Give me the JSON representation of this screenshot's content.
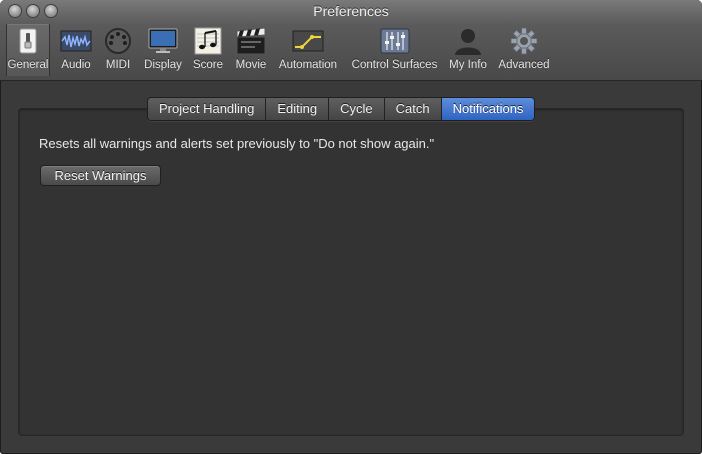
{
  "window": {
    "title": "Preferences"
  },
  "toolbar": {
    "items": [
      {
        "label": "General",
        "icon": "general-switch-icon",
        "selected": true
      },
      {
        "label": "Audio",
        "icon": "audio-waveform-icon"
      },
      {
        "label": "MIDI",
        "icon": "midi-connector-icon"
      },
      {
        "label": "Display",
        "icon": "display-monitor-icon"
      },
      {
        "label": "Score",
        "icon": "score-notes-icon"
      },
      {
        "label": "Movie",
        "icon": "movie-clapper-icon"
      },
      {
        "label": "Automation",
        "icon": "automation-curve-icon"
      },
      {
        "label": "Control Surfaces",
        "icon": "control-surfaces-faders-icon"
      },
      {
        "label": "My Info",
        "icon": "user-silhouette-icon"
      },
      {
        "label": "Advanced",
        "icon": "advanced-gear-icon"
      }
    ]
  },
  "tabs": {
    "items": [
      {
        "label": "Project Handling"
      },
      {
        "label": "Editing"
      },
      {
        "label": "Cycle"
      },
      {
        "label": "Catch"
      },
      {
        "label": "Notifications",
        "selected": true
      }
    ]
  },
  "notifications": {
    "description": "Resets all warnings and alerts set previously to \"Do not show again.\"",
    "reset_button_label": "Reset Warnings"
  },
  "colors": {
    "selected_tab": "#3a6fd0",
    "window_bg": "#3a3a3a",
    "panel_bg": "#333333"
  }
}
